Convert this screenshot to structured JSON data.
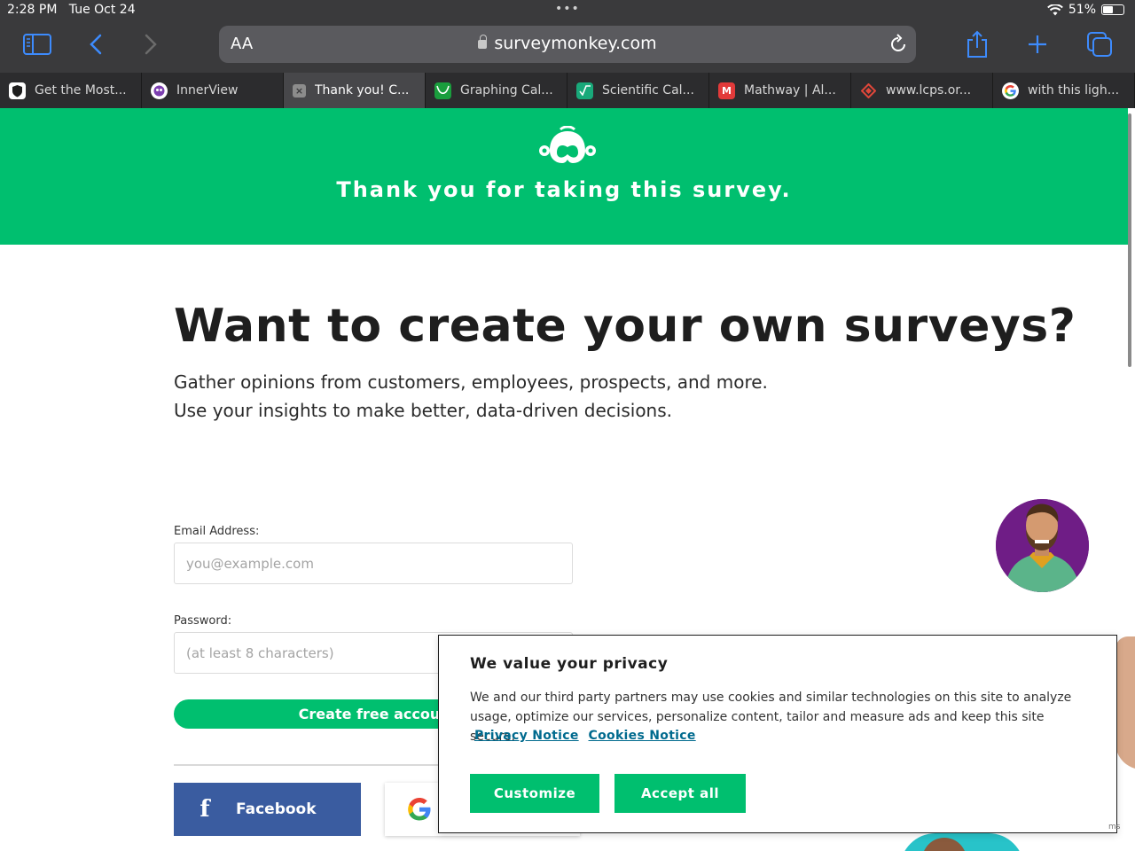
{
  "status_bar": {
    "time": "2:28 PM",
    "date": "Tue Oct 24",
    "battery": "51%",
    "battery_level": 0.51
  },
  "browser": {
    "reader_label": "AA",
    "url": "surveymonkey.com",
    "tabs": [
      {
        "label": "Get the Most...",
        "icon": "shield-favicon",
        "active": false
      },
      {
        "label": "InnerView",
        "icon": "innerview-favicon",
        "active": false
      },
      {
        "label": "Thank you! C...",
        "icon": "close-icon",
        "active": true
      },
      {
        "label": "Graphing Cal...",
        "icon": "graph-favicon",
        "active": false
      },
      {
        "label": "Scientific Cal...",
        "icon": "sqrt-favicon",
        "active": false
      },
      {
        "label": "Mathway | Al...",
        "icon": "mathway-favicon",
        "active": false
      },
      {
        "label": "www.lcps.or...",
        "icon": "lcps-favicon",
        "active": false
      },
      {
        "label": "with this ligh...",
        "icon": "google-favicon",
        "active": false
      }
    ]
  },
  "hero": {
    "title": "Thank you for taking this survey.",
    "bg_color": "#00bf6f"
  },
  "main": {
    "headline": "Want to create your own surveys?",
    "subline1": "Gather opinions from customers, employees, prospects, and more.",
    "subline2": "Use your insights to make better, data-driven decisions.",
    "email_label": "Email Address:",
    "email_placeholder": "you@example.com",
    "password_label": "Password:",
    "password_placeholder": "(at least 8 characters)",
    "create_button": "Create free account",
    "facebook_label": "Facebook"
  },
  "cookie_banner": {
    "title": "We value your privacy",
    "text": "We and our third party partners may use cookies and similar technologies on this site to analyze usage, optimize our services, personalize content, tailor and measure ads and keep this site secure.",
    "privacy_link": "Privacy Notice",
    "cookies_link": "Cookies Notice",
    "customize_button": "Customize",
    "accept_button": "Accept all",
    "corner_text": "ms"
  }
}
